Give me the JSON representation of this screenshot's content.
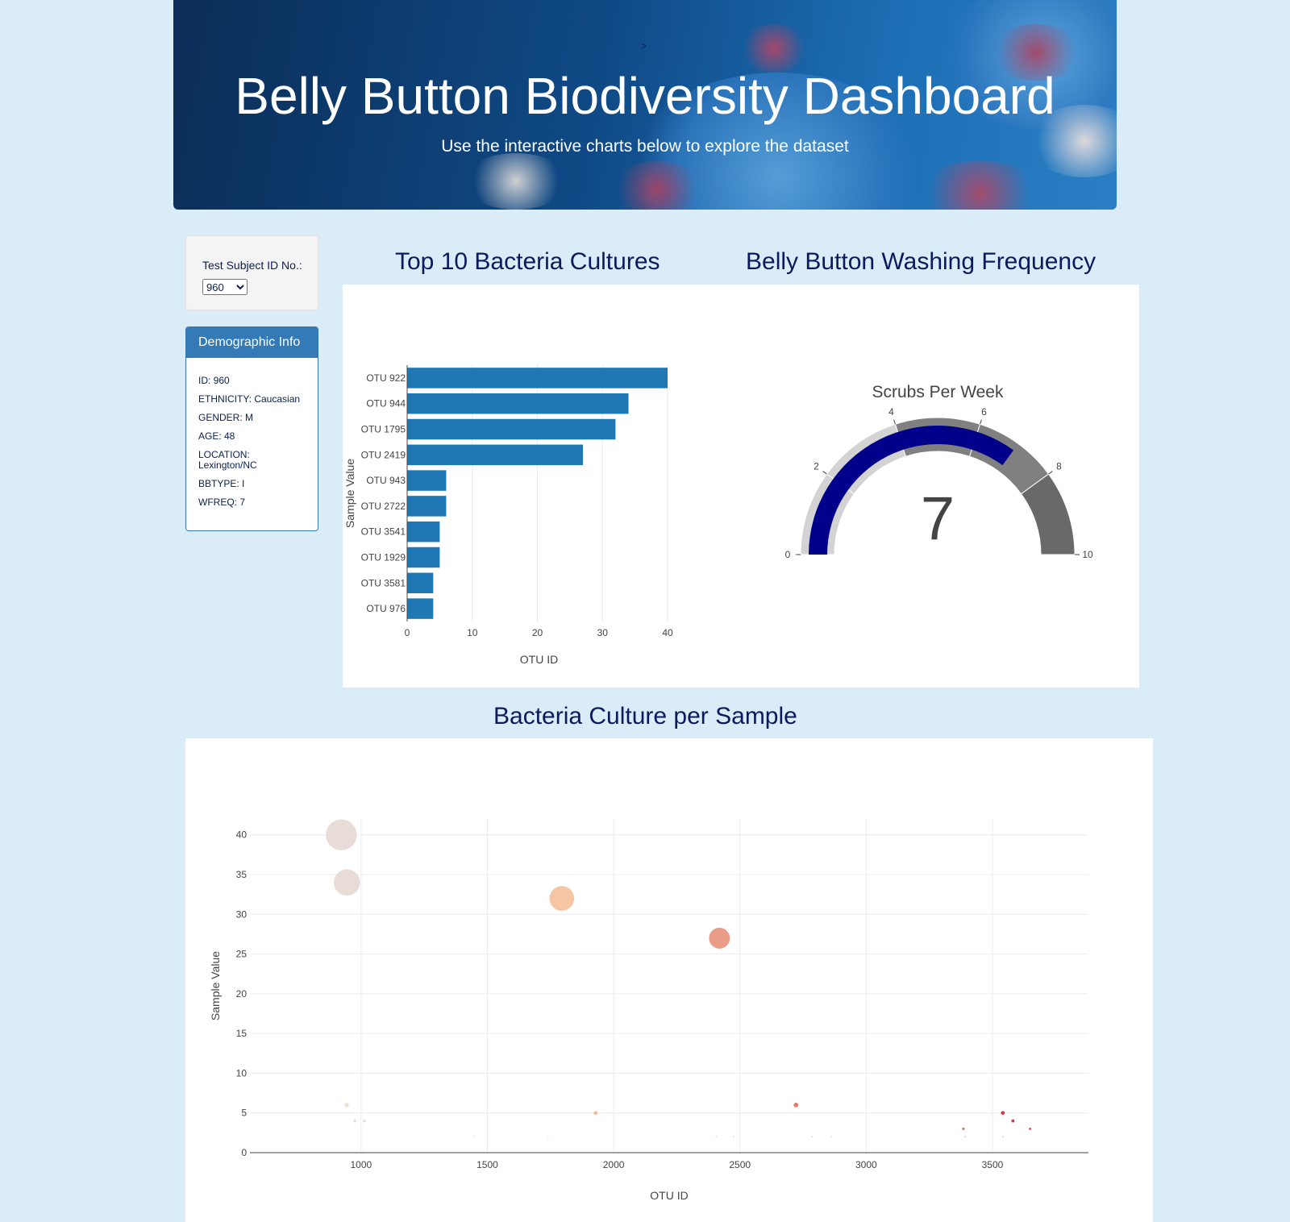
{
  "header": {
    "title": "Belly Button Biodiversity Dashboard",
    "subtitle": "Use the interactive charts below to explore the dataset",
    "marker": ">"
  },
  "selector": {
    "label": "Test Subject ID No.:",
    "value": "960"
  },
  "demographics": {
    "heading": "Demographic Info",
    "rows": [
      "ID: 960",
      "ETHNICITY: Caucasian",
      "GENDER: M",
      "AGE: 48",
      "LOCATION: Lexington/NC",
      "BBTYPE: I",
      "WFREQ: 7"
    ]
  },
  "headings": {
    "bar": "Top 10 Bacteria Cultures",
    "gauge": "Belly Button Washing Frequency",
    "bubble": "Bacteria Culture per Sample"
  },
  "colors": {
    "bar": "#1f77b4",
    "gauge_bar": "#00008b",
    "heading": "#0b1a5e"
  },
  "chart_data": [
    {
      "type": "bar",
      "orientation": "horizontal",
      "categories": [
        "OTU 922",
        "OTU 944",
        "OTU 1795",
        "OTU 2419",
        "OTU 943",
        "OTU 2722",
        "OTU 3541",
        "OTU 1929",
        "OTU 3581",
        "OTU 976"
      ],
      "values": [
        40,
        34,
        32,
        27,
        6,
        6,
        5,
        5,
        4,
        4
      ],
      "xlabel": "OTU ID",
      "ylabel": "Sample Value",
      "xlim": [
        0,
        40
      ],
      "xticks": [
        "0",
        "10",
        "20",
        "30",
        "40"
      ]
    },
    {
      "type": "gauge",
      "title": "Scrubs Per Week",
      "value": 7,
      "range": [
        0,
        10
      ],
      "ticks": [
        "0",
        "2",
        "4",
        "6",
        "8",
        "10"
      ],
      "steps": [
        {
          "range": [
            0,
            2
          ],
          "color": "#d3d3d3"
        },
        {
          "range": [
            2,
            4
          ],
          "color": "#d3d3d3"
        },
        {
          "range": [
            4,
            6
          ],
          "color": "#808080"
        },
        {
          "range": [
            6,
            8
          ],
          "color": "#808080"
        },
        {
          "range": [
            8,
            10
          ],
          "color": "#696969"
        }
      ]
    },
    {
      "type": "scatter",
      "subtype": "bubble",
      "xlabel": "OTU ID",
      "ylabel": "Sample Value",
      "xticks": [
        "1000",
        "1500",
        "2000",
        "2500",
        "3000",
        "3500"
      ],
      "yticks": [
        "0",
        "5",
        "10",
        "15",
        "20",
        "25",
        "30",
        "35",
        "40"
      ],
      "ylim": [
        0,
        42
      ],
      "xlim": [
        560,
        3880
      ],
      "points": [
        {
          "x": 922,
          "y": 40,
          "color": "#e6d9d2"
        },
        {
          "x": 944,
          "y": 34,
          "color": "#e6d9d2"
        },
        {
          "x": 1795,
          "y": 32,
          "color": "#f5c09a"
        },
        {
          "x": 2419,
          "y": 27,
          "color": "#e7927a"
        },
        {
          "x": 943,
          "y": 6,
          "color": "#e8e0c8"
        },
        {
          "x": 2722,
          "y": 6,
          "color": "#e06a5a"
        },
        {
          "x": 3541,
          "y": 5,
          "color": "#c92a3a"
        },
        {
          "x": 1929,
          "y": 5,
          "color": "#f4b08a"
        },
        {
          "x": 3581,
          "y": 4,
          "color": "#c92a3a"
        },
        {
          "x": 976,
          "y": 4,
          "color": "#e6ddd6"
        },
        {
          "x": 1013,
          "y": 4,
          "color": "#e6ddd6"
        },
        {
          "x": 3649,
          "y": 3,
          "color": "#d23a4a"
        },
        {
          "x": 3385,
          "y": 3,
          "color": "#d24a4a"
        },
        {
          "x": 1449,
          "y": 2,
          "color": "#eee6e0"
        },
        {
          "x": 1741,
          "y": 2,
          "color": "#f3e0d0"
        },
        {
          "x": 2406,
          "y": 2,
          "color": "#f0d8cc"
        },
        {
          "x": 2475,
          "y": 2,
          "color": "#f0d0c6"
        },
        {
          "x": 2786,
          "y": 2,
          "color": "#f0cfc6"
        },
        {
          "x": 2863,
          "y": 2,
          "color": "#f2d6cc"
        },
        {
          "x": 3392,
          "y": 2,
          "color": "#f0c0c0"
        },
        {
          "x": 3541,
          "y": 2,
          "color": "#f0c0c0"
        }
      ]
    }
  ]
}
